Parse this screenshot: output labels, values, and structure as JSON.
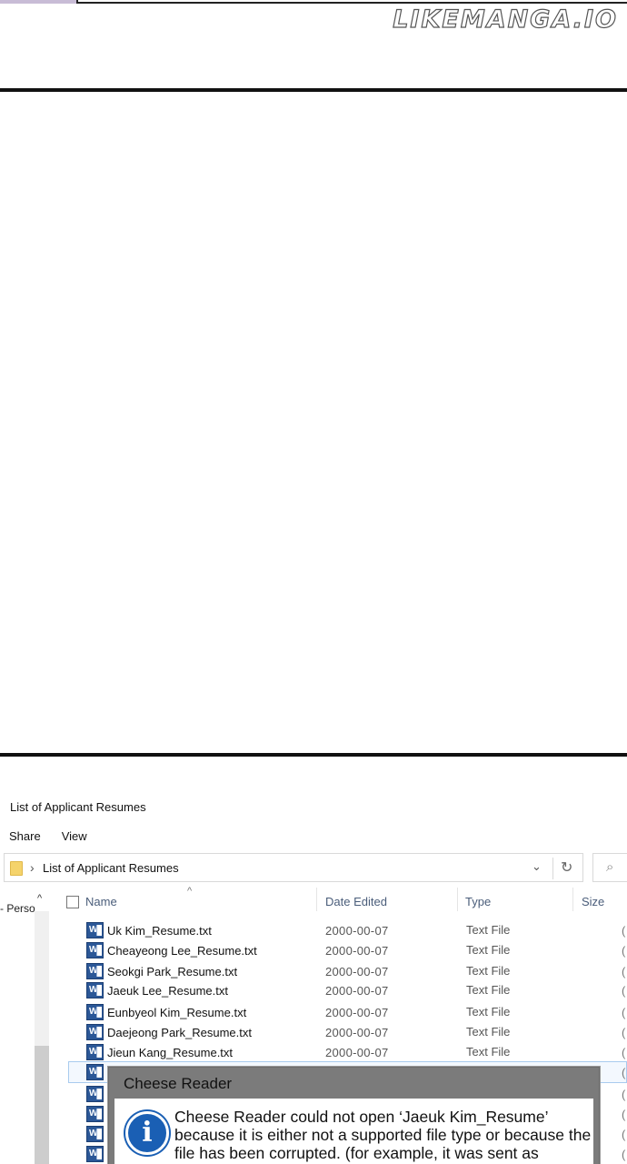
{
  "watermark": "LIKEMANGA.IO",
  "explorer": {
    "window_title": "List of Applicant Resumes",
    "ribbon": [
      "Share",
      "View"
    ],
    "address": {
      "crumb_separator": "›",
      "crumb": "List of Applicant Resumes",
      "dropdown_glyph": "⌄",
      "refresh_glyph": "↻",
      "search_glyph": "⌕"
    },
    "nav_pane": {
      "label": "- Perso",
      "scroll_up_glyph": "^"
    },
    "columns": {
      "sort_glyph": "^",
      "name": "Name",
      "date": "Date Edited",
      "type": "Type",
      "size": "Size"
    },
    "files": [
      {
        "name": "Uk Kim_Resume.txt",
        "date": "2000-00-07",
        "type": "Text File",
        "size": "("
      },
      {
        "name": "Cheayeong Lee_Resume.txt",
        "date": "2000-00-07",
        "type": "Text File",
        "size": "("
      },
      {
        "name": "Seokgi Park_Resume.txt",
        "date": "2000-00-07",
        "type": "Text File",
        "size": "("
      },
      {
        "name": "Jaeuk Lee_Resume.txt",
        "date": "2000-00-07",
        "type": "Text File",
        "size": "("
      },
      {
        "name": "Eunbyeol Kim_Resume.txt",
        "date": "2000-00-07",
        "type": "Text File",
        "size": "("
      },
      {
        "name": "Daejeong Park_Resume.txt",
        "date": "2000-00-07",
        "type": "Text File",
        "size": "("
      },
      {
        "name": "Jieun Kang_Resume.txt",
        "date": "2000-00-07",
        "type": "Text File",
        "size": "("
      },
      {
        "name": "",
        "date": "",
        "type": "",
        "size": "("
      },
      {
        "name": "",
        "date": "",
        "type": "",
        "size": "("
      },
      {
        "name": "",
        "date": "",
        "type": "",
        "size": "("
      },
      {
        "name": "",
        "date": "",
        "type": "",
        "size": "("
      },
      {
        "name": "",
        "date": "",
        "type": "",
        "size": "("
      },
      {
        "name": "",
        "date": "",
        "type": "",
        "size": "("
      }
    ],
    "file_icon_letter": "W"
  },
  "dialog": {
    "title": "Cheese Reader",
    "icon_glyph": "i",
    "message": "Cheese Reader could not open ‘Jaeuk Kim_Resume’ because it is either not a supported file type or because the file has been corrupted. (for example, it was sent as"
  },
  "colors": {
    "word_icon": "#2b5797",
    "dialog_titlebar": "#7b7b7b",
    "info_icon": "#1a5fb4",
    "header_text": "#4a5d7a"
  }
}
